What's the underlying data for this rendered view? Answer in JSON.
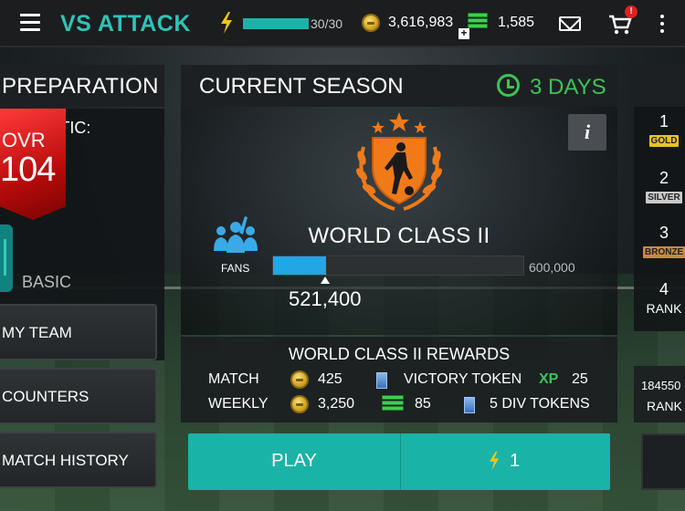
{
  "header": {
    "title": "VS ATTACK",
    "energy": {
      "text": "30/30",
      "fraction": 1.0
    },
    "coins": "3,616,983",
    "cash": "1,585",
    "cart_badge": "!",
    "cash_plus": "+"
  },
  "left_panel": {
    "title": "PREPARATION",
    "tactic_label": "VE TACTIC:",
    "ovr_label": "OVR",
    "ovr_value": "104",
    "tactic_name": "BASIC",
    "buttons": {
      "my_team": "MY TEAM",
      "counters": "COUNTERS",
      "match_history": "MATCH HISTORY"
    }
  },
  "season": {
    "title": "CURRENT SEASON",
    "days_left": "3 DAYS",
    "info": "i",
    "division": "WORLD CLASS II",
    "fans_label": "FANS",
    "fans_current": "521,400",
    "fans_max": "600,000",
    "progress_fraction": 0.21
  },
  "rewards": {
    "title": "WORLD CLASS II REWARDS",
    "match": {
      "label": "MATCH",
      "coins": "425",
      "token": "VICTORY TOKEN",
      "xp_label": "XP",
      "xp": "25"
    },
    "weekly": {
      "label": "WEEKLY",
      "coins": "3,250",
      "cash": "85",
      "tokens": "5 DIV TOKENS"
    }
  },
  "play": {
    "label": "PLAY",
    "cost": "1"
  },
  "right_panel": {
    "ranks": [
      {
        "num": "1",
        "tag": "GOLD",
        "color": "#e8c22a"
      },
      {
        "num": "2",
        "tag": "SILVER",
        "color": "#c9c9c9"
      },
      {
        "num": "3",
        "tag": "BRONZE",
        "color": "#c98a3a"
      },
      {
        "num": "4",
        "tag": "RANK"
      }
    ],
    "rank_points": "184550",
    "rank_label": "RANK"
  },
  "colors": {
    "accent": "#1ab3a7",
    "title_teal": "#2fc3b7",
    "days_green": "#3cc35a",
    "badge_orange": "#f07a18",
    "progress_blue": "#22a6e6"
  }
}
